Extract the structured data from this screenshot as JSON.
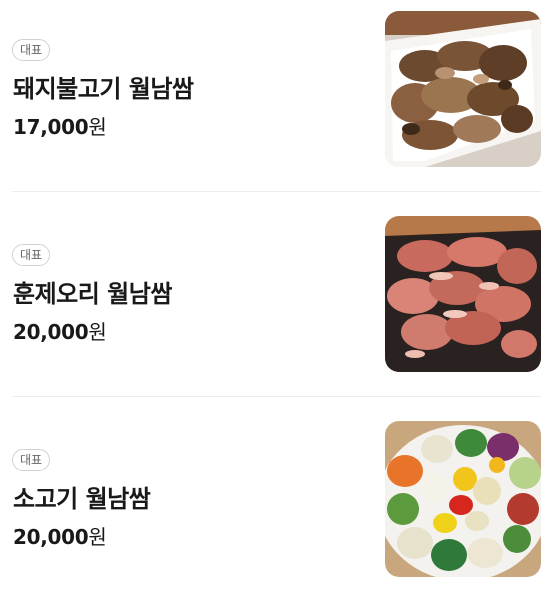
{
  "menu": {
    "items": [
      {
        "badge": "대표",
        "name": "돼지불고기 월남쌈",
        "price": "17,000",
        "unit": "원"
      },
      {
        "badge": "대표",
        "name": "훈제오리 월남쌈",
        "price": "20,000",
        "unit": "원"
      },
      {
        "badge": "대표",
        "name": "소고기 월남쌈",
        "price": "20,000",
        "unit": "원"
      }
    ]
  },
  "colors": {
    "text": "#191919",
    "badge_border": "#d2d2d2",
    "divider": "#ececec"
  }
}
